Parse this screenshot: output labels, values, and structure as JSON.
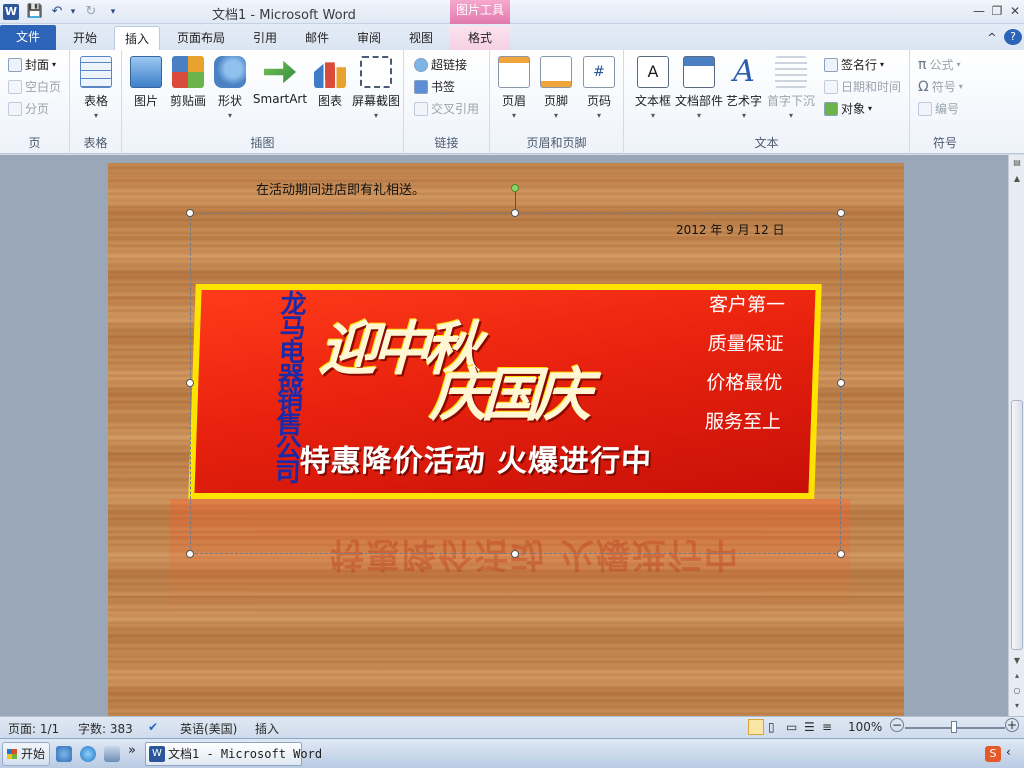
{
  "window": {
    "app_icon_letter": "W",
    "title": "文档1  -  Microsoft Word",
    "context_tab_group": "图片工具",
    "min_glyph": "—",
    "restore_glyph": "❐",
    "close_glyph": "✕"
  },
  "quick_access": {
    "save": "💾",
    "undo": "↶",
    "redo": "↻",
    "more": "▾"
  },
  "tabs": [
    {
      "label": "文件"
    },
    {
      "label": "开始"
    },
    {
      "label": "插入"
    },
    {
      "label": "页面布局"
    },
    {
      "label": "引用"
    },
    {
      "label": "邮件"
    },
    {
      "label": "审阅"
    },
    {
      "label": "视图"
    },
    {
      "label": "格式"
    }
  ],
  "ribbon_right": {
    "collapse": "^",
    "help": "?"
  },
  "ribbon": {
    "pages": {
      "label": "页",
      "cover": "封面",
      "blank": "空白页",
      "break": "分页"
    },
    "tables": {
      "label": "表格",
      "table": "表格"
    },
    "illustrations": {
      "label": "插图",
      "picture": "图片",
      "clipart": "剪贴画",
      "shapes": "形状",
      "smartart": "SmartArt",
      "chart": "图表",
      "screenshot": "屏幕截图"
    },
    "links": {
      "label": "链接",
      "hyperlink": "超链接",
      "bookmark": "书签",
      "crossref": "交叉引用"
    },
    "header_footer": {
      "label": "页眉和页脚",
      "header": "页眉",
      "footer": "页脚",
      "page_number": "页码"
    },
    "text": {
      "label": "文本",
      "textbox": "文本框",
      "quickparts": "文档部件",
      "wordart": "艺术字",
      "dropcap": "首字下沉",
      "signature": "签名行",
      "datetime": "日期和时间",
      "object": "对象"
    },
    "symbols": {
      "label": "符号",
      "equation": "公式",
      "symbol": "符号",
      "number": "编号"
    }
  },
  "document": {
    "line1": "在活动期间进店即有礼相送。",
    "date": "2012 年 9 月 12 日"
  },
  "banner": {
    "company": "龙马电器销售公司",
    "title_line1": "迎中秋",
    "title_line2": "庆国庆",
    "subtitle": "特惠降价活动 火爆进行中",
    "slogans": [
      "客户第一",
      "质量保证",
      "价格最优",
      "服务至上"
    ]
  },
  "status": {
    "page": "页面: 1/1",
    "words": "字数: 383",
    "language": "英语(美国)",
    "mode": "插入",
    "zoom": "100%",
    "zoom_out": "−",
    "zoom_in": "+"
  },
  "taskbar": {
    "start": "开始",
    "word_item": "文档1 - Microsoft Word",
    "word_icon_letter": "W",
    "more": "»"
  },
  "colors": {
    "accent": "#2b64b8",
    "context_tab": "#e07aae",
    "banner_red": "#e8220e",
    "banner_yellow": "#ffe300"
  }
}
